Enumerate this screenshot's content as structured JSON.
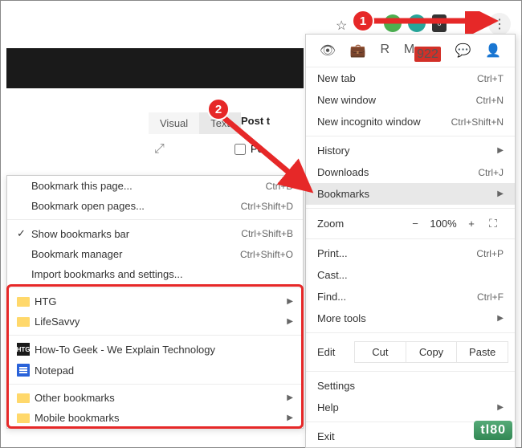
{
  "toolbar": {
    "star_glyph": "☆",
    "badge": "922",
    "dots_glyph": "⋮"
  },
  "editor": {
    "tabs": [
      "Visual",
      "Text"
    ],
    "post_label": "Post t",
    "expand_glyph": "⤢",
    "po_label": "Po"
  },
  "main_menu": {
    "icons": [
      "👁",
      "💼",
      "R",
      "M",
      "💬",
      "👤"
    ],
    "items_top": [
      {
        "label": "New tab",
        "shortcut": "Ctrl+T"
      },
      {
        "label": "New window",
        "shortcut": "Ctrl+N"
      },
      {
        "label": "New incognito window",
        "shortcut": "Ctrl+Shift+N"
      }
    ],
    "items_mid": [
      {
        "label": "History",
        "submenu": true
      },
      {
        "label": "Downloads",
        "shortcut": "Ctrl+J"
      },
      {
        "label": "Bookmarks",
        "submenu": true,
        "highlighted": true
      }
    ],
    "zoom": {
      "label": "Zoom",
      "minus": "−",
      "value": "100%",
      "plus": "+",
      "fullscreen": "⛶"
    },
    "items_print": [
      {
        "label": "Print...",
        "shortcut": "Ctrl+P"
      },
      {
        "label": "Cast..."
      },
      {
        "label": "Find...",
        "shortcut": "Ctrl+F"
      },
      {
        "label": "More tools",
        "submenu": true
      }
    ],
    "edit": {
      "label": "Edit",
      "cut": "Cut",
      "copy": "Copy",
      "paste": "Paste"
    },
    "items_bottom": [
      {
        "label": "Settings"
      },
      {
        "label": "Help",
        "submenu": true
      }
    ],
    "exit": {
      "label": "Exit"
    }
  },
  "bookmarks_submenu": {
    "top": [
      {
        "label": "Bookmark this page...",
        "shortcut": "Ctrl+D"
      },
      {
        "label": "Bookmark open pages...",
        "shortcut": "Ctrl+Shift+D"
      }
    ],
    "mid": [
      {
        "label": "Show bookmarks bar",
        "shortcut": "Ctrl+Shift+B",
        "checked": true
      },
      {
        "label": "Bookmark manager",
        "shortcut": "Ctrl+Shift+O"
      },
      {
        "label": "Import bookmarks and settings..."
      }
    ],
    "folders1": [
      {
        "label": "HTG",
        "icon": "folder",
        "submenu": true
      },
      {
        "label": "LifeSavvy",
        "icon": "folder",
        "submenu": true
      }
    ],
    "pages": [
      {
        "label": "How-To Geek - We Explain Technology",
        "icon": "htg"
      },
      {
        "label": "Notepad",
        "icon": "doc"
      }
    ],
    "folders2": [
      {
        "label": "Other bookmarks",
        "icon": "folder",
        "submenu": true
      },
      {
        "label": "Mobile bookmarks",
        "icon": "folder",
        "submenu": true
      }
    ]
  },
  "callouts": {
    "one": "1",
    "two": "2"
  },
  "watermark": "tl80"
}
